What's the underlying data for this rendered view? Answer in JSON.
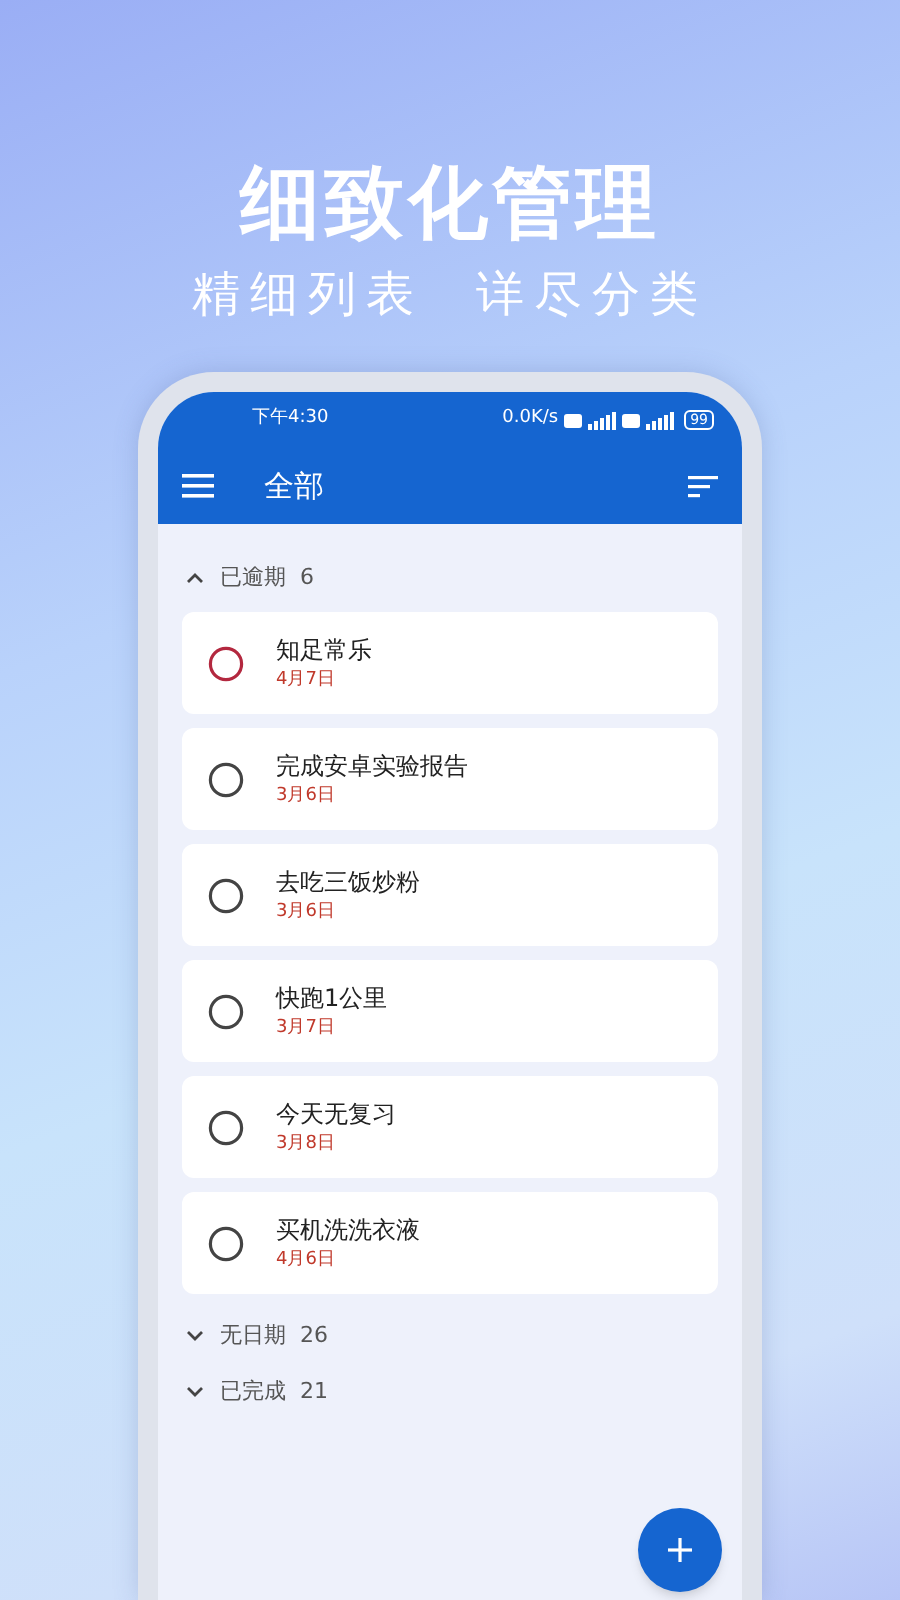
{
  "promo": {
    "headline": "细致化管理",
    "taglines": [
      "精细列表",
      "详尽分类"
    ]
  },
  "status_bar": {
    "time": "下午4:30",
    "net_speed": "0.0K/s",
    "battery": "99"
  },
  "app_bar": {
    "title": "全部"
  },
  "groups": [
    {
      "label": "已逾期",
      "count": "6",
      "expanded": true,
      "tasks": [
        {
          "title": "知足常乐",
          "date": "4月7日",
          "color": "#b3283f"
        },
        {
          "title": "完成安卓实验报告",
          "date": "3月6日",
          "color": "#444444"
        },
        {
          "title": "去吃三饭炒粉",
          "date": "3月6日",
          "color": "#444444"
        },
        {
          "title": "快跑1公里",
          "date": "3月7日",
          "color": "#444444"
        },
        {
          "title": "今天无复习",
          "date": "3月8日",
          "color": "#444444"
        },
        {
          "title": "买机洗洗衣液",
          "date": "4月6日",
          "color": "#444444"
        }
      ]
    },
    {
      "label": "无日期",
      "count": "26",
      "expanded": false
    },
    {
      "label": "已完成",
      "count": "21",
      "expanded": false
    }
  ]
}
